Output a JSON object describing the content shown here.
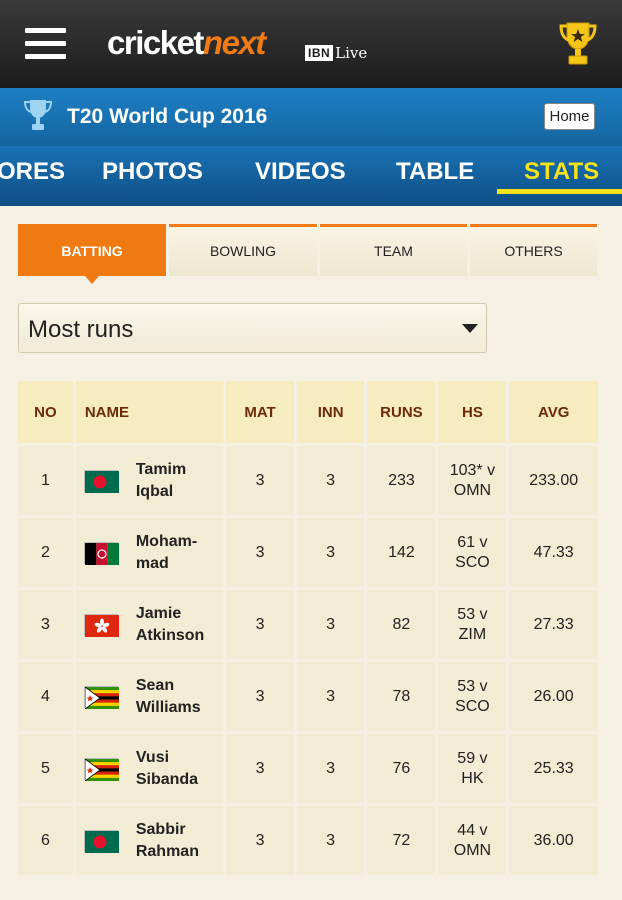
{
  "header": {
    "logo_primary": "cricket",
    "logo_accent": "next",
    "logo_partner": "IBN",
    "logo_partner_suffix": "Live"
  },
  "title_bar": {
    "title": "T20 World Cup 2016",
    "home_label": "Home"
  },
  "nav": {
    "items": [
      {
        "label": "ORES"
      },
      {
        "label": "PHOTOS"
      },
      {
        "label": "VIDEOS"
      },
      {
        "label": "TABLE"
      },
      {
        "label": "STATS",
        "active": true
      }
    ]
  },
  "subtabs": [
    {
      "label": "BATTING",
      "active": true
    },
    {
      "label": "BOWLING"
    },
    {
      "label": "TEAM"
    },
    {
      "label": "OTHERS"
    }
  ],
  "dropdown": {
    "selected": "Most runs"
  },
  "table": {
    "headers": [
      "NO",
      "NAME",
      "MAT",
      "INN",
      "RUNS",
      "HS",
      "AVG"
    ],
    "rows": [
      {
        "no": "1",
        "flag": "bangladesh",
        "name_line1": "Tamim",
        "name_line2": "Iqbal",
        "mat": "3",
        "inn": "3",
        "runs": "233",
        "hs_line1": "103* v",
        "hs_line2": "OMN",
        "avg": "233.00"
      },
      {
        "no": "2",
        "flag": "afghanistan",
        "name_line1": "Moham-",
        "name_line2": "mad",
        "mat": "3",
        "inn": "3",
        "runs": "142",
        "hs_line1": "61 v",
        "hs_line2": "SCO",
        "avg": "47.33"
      },
      {
        "no": "3",
        "flag": "hongkong",
        "name_line1": "Jamie",
        "name_line2": "Atkinson",
        "mat": "3",
        "inn": "3",
        "runs": "82",
        "hs_line1": "53 v",
        "hs_line2": "ZIM",
        "avg": "27.33"
      },
      {
        "no": "4",
        "flag": "zimbabwe",
        "name_line1": "Sean",
        "name_line2": "Williams",
        "mat": "3",
        "inn": "3",
        "runs": "78",
        "hs_line1": "53 v",
        "hs_line2": "SCO",
        "avg": "26.00"
      },
      {
        "no": "5",
        "flag": "zimbabwe",
        "name_line1": "Vusi",
        "name_line2": "Sibanda",
        "mat": "3",
        "inn": "3",
        "runs": "76",
        "hs_line1": "59 v",
        "hs_line2": "HK",
        "avg": "25.33"
      },
      {
        "no": "6",
        "flag": "bangladesh",
        "name_line1": "Sabbir",
        "name_line2": "Rahman",
        "mat": "3",
        "inn": "3",
        "runs": "72",
        "hs_line1": "44 v",
        "hs_line2": "OMN",
        "avg": "36.00"
      }
    ]
  },
  "colors": {
    "accent_orange": "#ef7a12",
    "nav_blue": "#1a72b4",
    "active_yellow": "#f5e21a",
    "header_text": "#6b2a0a"
  }
}
